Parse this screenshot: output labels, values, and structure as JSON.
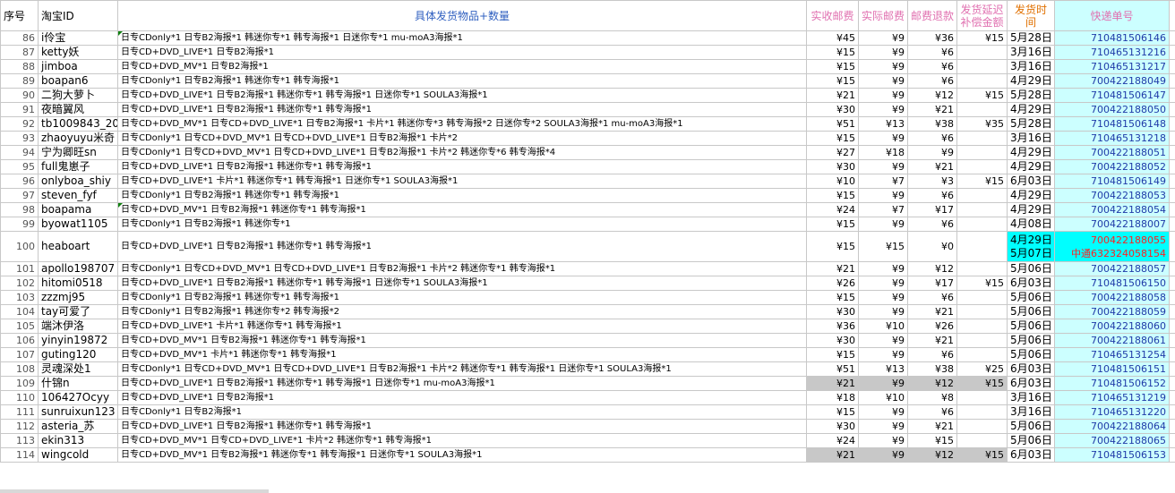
{
  "headers": {
    "seq": "序号",
    "id": "淘宝ID",
    "items": "具体发货物品+数量",
    "paid_shipping": "实收邮费",
    "actual_shipping": "实际邮费",
    "refund": "邮费退款",
    "delay_comp": "发货延迟补偿金额",
    "ship_time": "发货时间",
    "tracking": "快递单号"
  },
  "rows": [
    {
      "seq": "86",
      "id": "i伶宝",
      "items": "日专CDonly*1 日专B2海报*1 韩迷你专*1 韩专海报*1 日迷你专*1 mu-moA3海报*1",
      "paid": "¥45",
      "actual": "¥9",
      "refund": "¥36",
      "comp": "¥15",
      "date": "5月28日",
      "track": "710481506146",
      "tri": true
    },
    {
      "seq": "87",
      "id": "ketty妖",
      "items": "日专CD+DVD_LIVE*1 日专B2海报*1",
      "paid": "¥15",
      "actual": "¥9",
      "refund": "¥6",
      "comp": "",
      "date": "3月16日",
      "track": "710465131216"
    },
    {
      "seq": "88",
      "id": "jimboa",
      "items": "日专CD+DVD_MV*1 日专B2海报*1",
      "paid": "¥15",
      "actual": "¥9",
      "refund": "¥6",
      "comp": "",
      "date": "3月16日",
      "track": "710465131217"
    },
    {
      "seq": "89",
      "id": "boapan6",
      "items": "日专CDonly*1 日专B2海报*1 韩迷你专*1 韩专海报*1",
      "paid": "¥15",
      "actual": "¥9",
      "refund": "¥6",
      "comp": "",
      "date": "4月29日",
      "track": "700422188049"
    },
    {
      "seq": "90",
      "id": "二狗大萝卜",
      "items": "日专CD+DVD_LIVE*1 日专B2海报*1 韩迷你专*1 韩专海报*1 日迷你专*1 SOULA3海报*1",
      "paid": "¥21",
      "actual": "¥9",
      "refund": "¥12",
      "comp": "¥15",
      "date": "5月28日",
      "track": "710481506147"
    },
    {
      "seq": "91",
      "id": "夜暗翼风",
      "items": "日专CD+DVD_LIVE*1 日专B2海报*1 韩迷你专*1 韩专海报*1",
      "paid": "¥30",
      "actual": "¥9",
      "refund": "¥21",
      "comp": "",
      "date": "4月29日",
      "track": "700422188050"
    },
    {
      "seq": "92",
      "id": "tb1009843_20",
      "items": "日专CD+DVD_MV*1 日专CD+DVD_LIVE*1 日专B2海报*1 卡片*1 韩迷你专*3 韩专海报*2 日迷你专*2 SOULA3海报*1 mu-moA3海报*1",
      "paid": "¥51",
      "actual": "¥13",
      "refund": "¥38",
      "comp": "¥35",
      "date": "5月28日",
      "track": "710481506148"
    },
    {
      "seq": "93",
      "id": "zhaoyuyu米奇",
      "items": "日专CDonly*1 日专CD+DVD_MV*1 日专CD+DVD_LIVE*1 日专B2海报*1 卡片*2",
      "paid": "¥15",
      "actual": "¥9",
      "refund": "¥6",
      "comp": "",
      "date": "3月16日",
      "track": "710465131218"
    },
    {
      "seq": "94",
      "id": "宁为卿旺sn",
      "items": "日专CDonly*1 日专CD+DVD_MV*1 日专CD+DVD_LIVE*1 日专B2海报*1 卡片*2 韩迷你专*6 韩专海报*4",
      "paid": "¥27",
      "actual": "¥18",
      "refund": "¥9",
      "comp": "",
      "date": "4月29日",
      "track": "700422188051"
    },
    {
      "seq": "95",
      "id": "full鬼崽子",
      "items": "日专CD+DVD_LIVE*1 日专B2海报*1 韩迷你专*1 韩专海报*1",
      "paid": "¥30",
      "actual": "¥9",
      "refund": "¥21",
      "comp": "",
      "date": "4月29日",
      "track": "700422188052"
    },
    {
      "seq": "96",
      "id": "onlyboa_shiy",
      "items": "日专CD+DVD_LIVE*1 卡片*1 韩迷你专*1 韩专海报*1 日迷你专*1 SOULA3海报*1",
      "paid": "¥10",
      "actual": "¥7",
      "refund": "¥3",
      "comp": "¥15",
      "date": "6月03日",
      "track": "710481506149"
    },
    {
      "seq": "97",
      "id": "steven_fyf",
      "items": "日专CDonly*1 日专B2海报*1 韩迷你专*1 韩专海报*1",
      "paid": "¥15",
      "actual": "¥9",
      "refund": "¥6",
      "comp": "",
      "date": "4月29日",
      "track": "700422188053"
    },
    {
      "seq": "98",
      "id": "boapama",
      "items": "日专CD+DVD_MV*1 日专B2海报*1 韩迷你专*1 韩专海报*1",
      "paid": "¥24",
      "actual": "¥7",
      "refund": "¥17",
      "comp": "",
      "date": "4月29日",
      "track": "700422188054",
      "tri": true
    },
    {
      "seq": "99",
      "id": "byowat1105",
      "items": "日专CDonly*1 日专B2海报*1 韩迷你专*1",
      "paid": "¥15",
      "actual": "¥9",
      "refund": "¥6",
      "comp": "",
      "date": "4月08日",
      "track": "700422188007"
    },
    {
      "seq": "100",
      "id": "heaboart",
      "items": "日专CD+DVD_LIVE*1 日专B2海报*1 韩迷你专*1 韩专海报*1",
      "paid": "¥15",
      "actual": "¥15",
      "refund": "¥0",
      "comp": "",
      "date": "4月29日",
      "date2": "5月07日",
      "track": "700422188055",
      "track2": "中通632324058154",
      "tall": true
    },
    {
      "seq": "101",
      "id": "apollo198707",
      "items": "日专CDonly*1 日专CD+DVD_MV*1 日专CD+DVD_LIVE*1 日专B2海报*1 卡片*2 韩迷你专*1 韩专海报*1",
      "paid": "¥21",
      "actual": "¥9",
      "refund": "¥12",
      "comp": "",
      "date": "5月06日",
      "track": "700422188057"
    },
    {
      "seq": "102",
      "id": "hitomi0518",
      "items": "日专CD+DVD_LIVE*1 日专B2海报*1 韩迷你专*1 韩专海报*1 日迷你专*1 SOULA3海报*1",
      "paid": "¥26",
      "actual": "¥9",
      "refund": "¥17",
      "comp": "¥15",
      "date": "6月03日",
      "track": "710481506150"
    },
    {
      "seq": "103",
      "id": "zzzmj95",
      "items": "日专CDonly*1 日专B2海报*1 韩迷你专*1 韩专海报*1",
      "paid": "¥15",
      "actual": "¥9",
      "refund": "¥6",
      "comp": "",
      "date": "5月06日",
      "track": "700422188058"
    },
    {
      "seq": "104",
      "id": "tay可爱了",
      "items": "日专CDonly*1 日专B2海报*1 韩迷你专*2 韩专海报*2",
      "paid": "¥30",
      "actual": "¥9",
      "refund": "¥21",
      "comp": "",
      "date": "5月06日",
      "track": "700422188059"
    },
    {
      "seq": "105",
      "id": "端沐伊洛",
      "items": "日专CD+DVD_LIVE*1 卡片*1 韩迷你专*1 韩专海报*1",
      "paid": "¥36",
      "actual": "¥10",
      "refund": "¥26",
      "comp": "",
      "date": "5月06日",
      "track": "700422188060",
      "mark": true
    },
    {
      "seq": "106",
      "id": "yinyin19872",
      "items": "日专CD+DVD_MV*1 日专B2海报*1 韩迷你专*1 韩专海报*1",
      "paid": "¥30",
      "actual": "¥9",
      "refund": "¥21",
      "comp": "",
      "date": "5月06日",
      "track": "700422188061"
    },
    {
      "seq": "107",
      "id": "guting120",
      "items": "日专CD+DVD_MV*1 卡片*1 韩迷你专*1 韩专海报*1",
      "paid": "¥15",
      "actual": "¥9",
      "refund": "¥6",
      "comp": "",
      "date": "5月06日",
      "track": "710465131254"
    },
    {
      "seq": "108",
      "id": "灵魂深处1",
      "items": "日专CDonly*1 日专CD+DVD_MV*1 日专CD+DVD_LIVE*1 日专B2海报*1 卡片*2 韩迷你专*1 韩专海报*1 日迷你专*1 SOULA3海报*1",
      "paid": "¥51",
      "actual": "¥13",
      "refund": "¥38",
      "comp": "¥25",
      "date": "6月03日",
      "track": "710481506151"
    },
    {
      "seq": "109",
      "id": "什锦n",
      "items": "日专CD+DVD_LIVE*1 日专B2海报*1 韩迷你专*1 韩专海报*1 日迷你专*1 mu-moA3海报*1",
      "paid": "¥21",
      "actual": "¥9",
      "refund": "¥12",
      "comp": "¥15",
      "date": "6月03日",
      "track": "710481506152",
      "gray": true
    },
    {
      "seq": "110",
      "id": "106427Ocyy",
      "items": "日专CD+DVD_LIVE*1 日专B2海报*1",
      "paid": "¥18",
      "actual": "¥10",
      "refund": "¥8",
      "comp": "",
      "date": "3月16日",
      "track": "710465131219"
    },
    {
      "seq": "111",
      "id": "sunruixun123",
      "items": "日专CDonly*1 日专B2海报*1",
      "paid": "¥15",
      "actual": "¥9",
      "refund": "¥6",
      "comp": "",
      "date": "3月16日",
      "track": "710465131220"
    },
    {
      "seq": "112",
      "id": "asteria_苏",
      "items": "日专CD+DVD_LIVE*1 日专B2海报*1 韩迷你专*1 韩专海报*1",
      "paid": "¥30",
      "actual": "¥9",
      "refund": "¥21",
      "comp": "",
      "date": "5月06日",
      "track": "700422188064"
    },
    {
      "seq": "113",
      "id": "ekin313",
      "items": "日专CD+DVD_MV*1 日专CD+DVD_LIVE*1 卡片*2 韩迷你专*1 韩专海报*1",
      "paid": "¥24",
      "actual": "¥9",
      "refund": "¥15",
      "comp": "",
      "date": "5月06日",
      "track": "700422188065"
    },
    {
      "seq": "114",
      "id": "wingcold",
      "items": "日专CD+DVD_MV*1 日专B2海报*1 韩迷你专*1 韩专海报*1 日迷你专*1 SOULA3海报*1",
      "paid": "¥21",
      "actual": "¥9",
      "refund": "¥12",
      "comp": "¥15",
      "date": "6月03日",
      "track": "710481506153",
      "gray": true
    }
  ]
}
